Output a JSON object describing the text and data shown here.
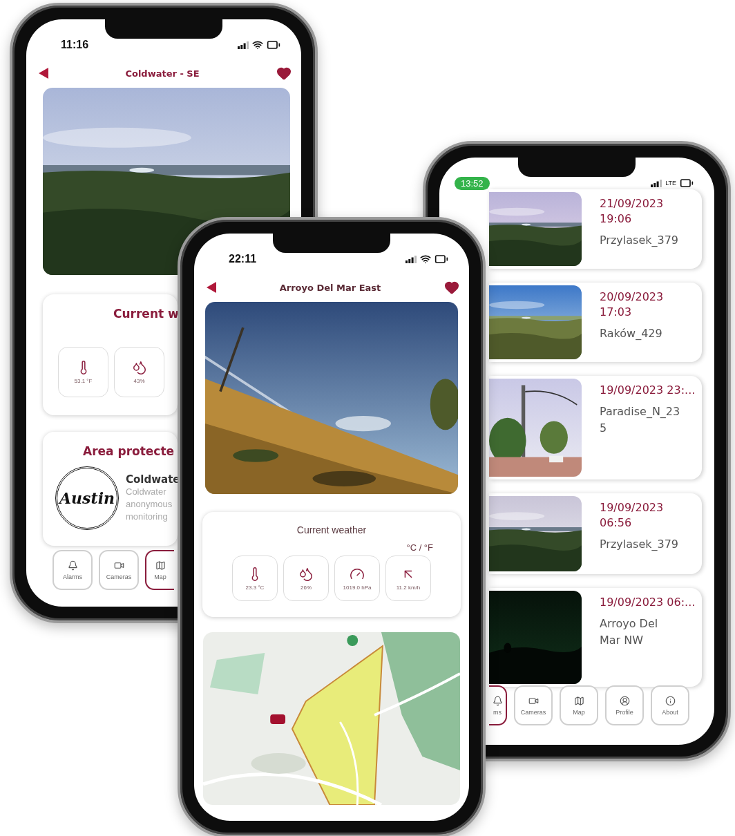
{
  "back_left_phone": {
    "time": "11:16",
    "title": "Coldwater - SE",
    "favorite": true,
    "weather": {
      "title": "Current w",
      "tiles": [
        {
          "kind": "temperature",
          "value": "53.1 °F"
        },
        {
          "kind": "humidity",
          "value": "43%"
        }
      ]
    },
    "area": {
      "title": "Area protecte",
      "logo": "Austin",
      "name": "Coldwate",
      "lines": [
        "Coldwater",
        "anonymous",
        "monitoring"
      ]
    },
    "tabs": [
      {
        "kind": "alarms",
        "label": "Alarms",
        "selected": false
      },
      {
        "kind": "cameras",
        "label": "Cameras",
        "selected": false
      },
      {
        "kind": "map",
        "label": "Map",
        "selected": true
      }
    ]
  },
  "back_right_phone": {
    "time": "13:52",
    "network": "LTE",
    "items": [
      {
        "date": "21/09/2023\n19:06",
        "name": "Przylasek_379"
      },
      {
        "date": "20/09/2023\n17:03",
        "name": "Raków_429"
      },
      {
        "date": "19/09/2023 23:...",
        "name": "Paradise_N_23\n5"
      },
      {
        "date": "19/09/2023\n06:56",
        "name": "Przylasek_379"
      },
      {
        "date": "19/09/2023 06:...",
        "name": "Arroyo Del\nMar NW"
      }
    ],
    "tabs": [
      {
        "kind": "alarms",
        "label": "ms",
        "selected": true
      },
      {
        "kind": "cameras",
        "label": "Cameras",
        "selected": false
      },
      {
        "kind": "map",
        "label": "Map",
        "selected": false
      },
      {
        "kind": "profile",
        "label": "Profile",
        "selected": false
      },
      {
        "kind": "about",
        "label": "About",
        "selected": false
      }
    ]
  },
  "front_phone": {
    "time": "22:11",
    "title": "Arroyo Del Mar East",
    "favorite": true,
    "weather": {
      "title": "Current weather",
      "units": "°C / °F",
      "tiles": [
        {
          "kind": "temperature",
          "value": "23.3 °C"
        },
        {
          "kind": "humidity",
          "value": "26%"
        },
        {
          "kind": "pressure",
          "value": "1019.0 hPa"
        },
        {
          "kind": "wind",
          "value": "11.2 km/h"
        }
      ]
    }
  }
}
